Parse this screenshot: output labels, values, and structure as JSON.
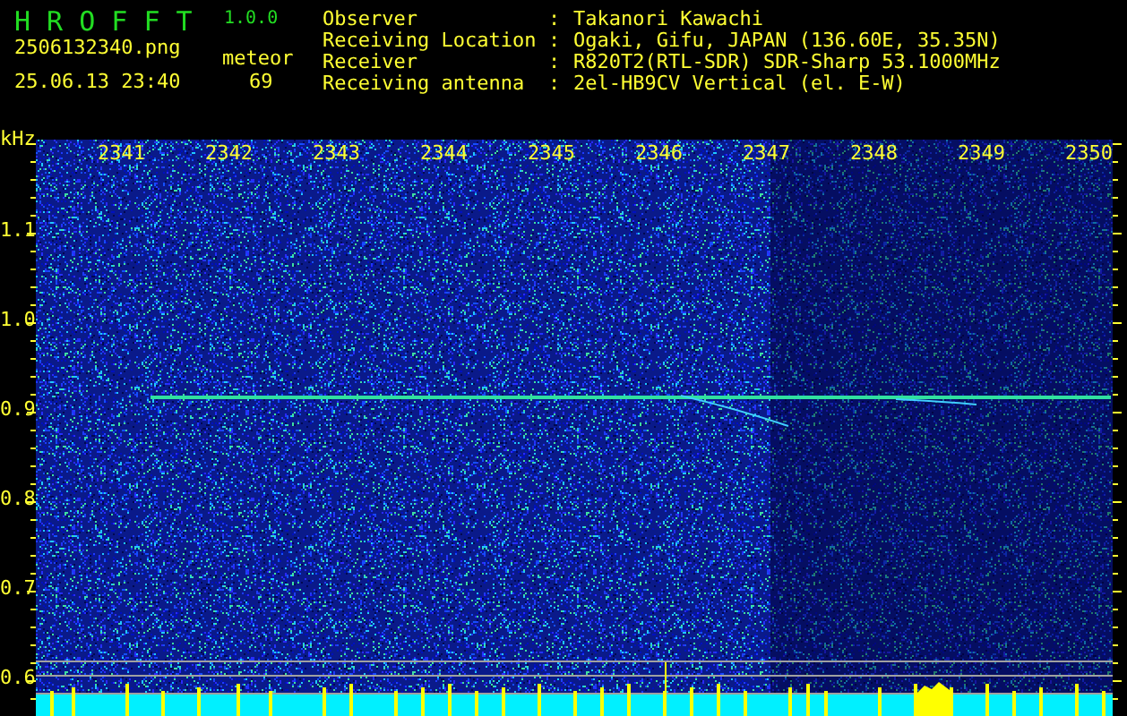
{
  "app": {
    "title": "H R O F F T",
    "version": "1.0.0"
  },
  "file": "2506132340.png",
  "timestamp": "25.06.13 23:40",
  "meteor": {
    "label": "meteor",
    "count": "69"
  },
  "info": [
    {
      "label": "Observer",
      "separator": ":",
      "value": "Takanori Kawachi"
    },
    {
      "label": "Receiving Location",
      "separator": ":",
      "value": "Ogaki, Gifu, JAPAN (136.60E, 35.35N)"
    },
    {
      "label": "Receiver",
      "separator": ":",
      "value": "R820T2(RTL-SDR) SDR-Sharp 53.1000MHz"
    },
    {
      "label": "Receiving antenna",
      "separator": ":",
      "value": "2el-HB9CV Vertical (el. E-W)"
    }
  ],
  "axes": {
    "y_unit": "kHz",
    "x_labels": [
      "2341",
      "2342",
      "2343",
      "2344",
      "2345",
      "2346",
      "2347",
      "2348",
      "2349",
      "2350"
    ],
    "y_labels": [
      "1.1",
      "1.0",
      "0.9",
      "0.8",
      "0.7",
      "0.6"
    ]
  }
}
